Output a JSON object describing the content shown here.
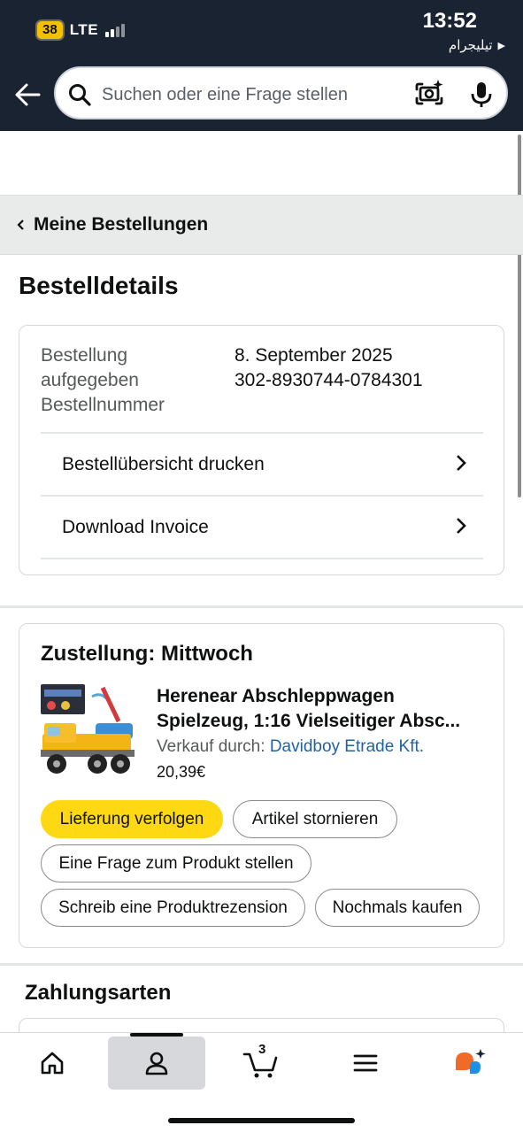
{
  "status_bar": {
    "battery": "38",
    "network": "LTE",
    "time": "13:52",
    "back_app_label": "تیلیجرام"
  },
  "search": {
    "placeholder": "Suchen oder eine Frage stellen"
  },
  "breadcrumb": {
    "label": "Meine Bestellungen"
  },
  "page_title": "Bestelldetails",
  "order_info": {
    "label_lines": [
      "Bestellung",
      "aufgegeben",
      "Bestellnummer"
    ],
    "order_date": "8. September 2025",
    "order_number": "302-8930744-0784301",
    "links": [
      {
        "label": "Bestellübersicht drucken"
      },
      {
        "label": "Download Invoice"
      }
    ]
  },
  "delivery": {
    "title": "Zustellung: Mittwoch",
    "product_title_line1": "Herenear Abschleppwagen",
    "product_title_line2": "Spielzeug, 1:16 Vielseitiger Absc...",
    "seller_prefix": "Verkauf durch:",
    "seller_name": "Davidboy Etrade Kft.",
    "price": "20,39€",
    "actions": {
      "track": "Lieferung verfolgen",
      "cancel": "Artikel stornieren",
      "question": "Eine Frage zum Produkt stellen",
      "review": "Schreib eine Produktrezension",
      "rebuy": "Nochmals kaufen"
    }
  },
  "payment": {
    "title": "Zahlungsarten"
  },
  "bottom_nav": {
    "cart_count": "3",
    "items": [
      "home-icon",
      "account-icon",
      "cart-icon",
      "menu-icon",
      "rufus-icon"
    ],
    "active": "account-icon"
  },
  "colors": {
    "header_bg": "#1a2332",
    "primary_button": "#ffd814",
    "link": "#2162a1",
    "battery": "#f2c200"
  }
}
